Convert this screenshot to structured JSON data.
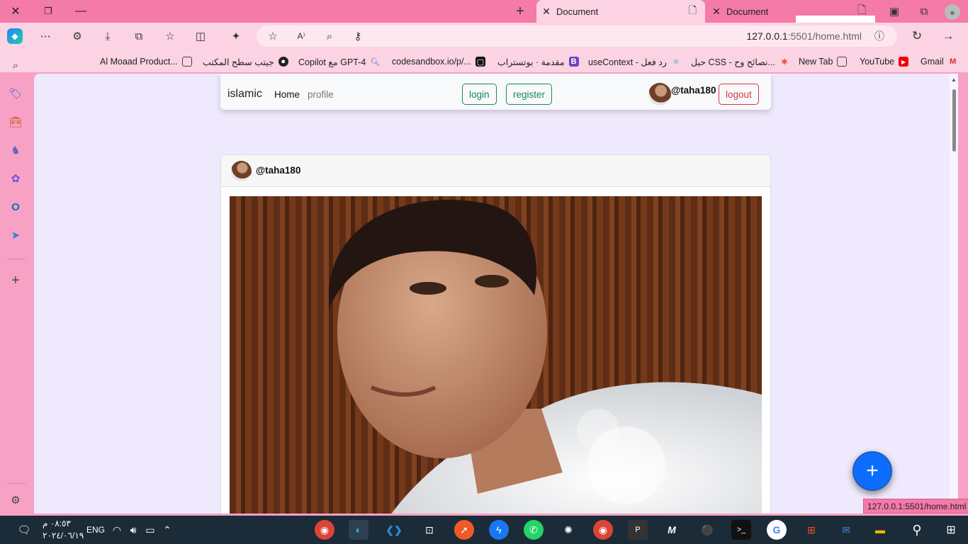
{
  "browser": {
    "tabs": [
      {
        "title": "Document"
      },
      {
        "title": "Document"
      }
    ],
    "address": {
      "host": "127.0.0.1",
      "rest": ":5501/home.html"
    },
    "bookmarks": [
      "Al Moaad Product...",
      "جيتب سطح المكتب",
      "Copilot مع GPT-4",
      "codesandbox.io/p/...",
      "مقدمة · بوتستراب",
      "useContext - رد فعل",
      "حيل CSS - نصائح وح...",
      "New Tab",
      "YouTube",
      "Gmail"
    ],
    "status_url": "127.0.0.1:5501/home.html"
  },
  "page": {
    "navbar": {
      "brand": "islamic",
      "links": [
        "Home",
        "profile"
      ],
      "login": "login",
      "register": "register",
      "username": "@taha180",
      "logout": "logout"
    },
    "post": {
      "username": "@taha180"
    },
    "fab": "+"
  },
  "taskbar": {
    "time": "٠٨:٥٣ م",
    "date": "٢٠٢٤/٠٦/١٩",
    "lang": "ENG"
  },
  "colors": {
    "titlebar": "#f47aa8",
    "toolbar": "#fbd3e3",
    "page_bg": "#efe9fd",
    "success": "#198754",
    "danger": "#dc3545",
    "primary": "#0d6efd",
    "taskbar": "#1c2b38"
  }
}
